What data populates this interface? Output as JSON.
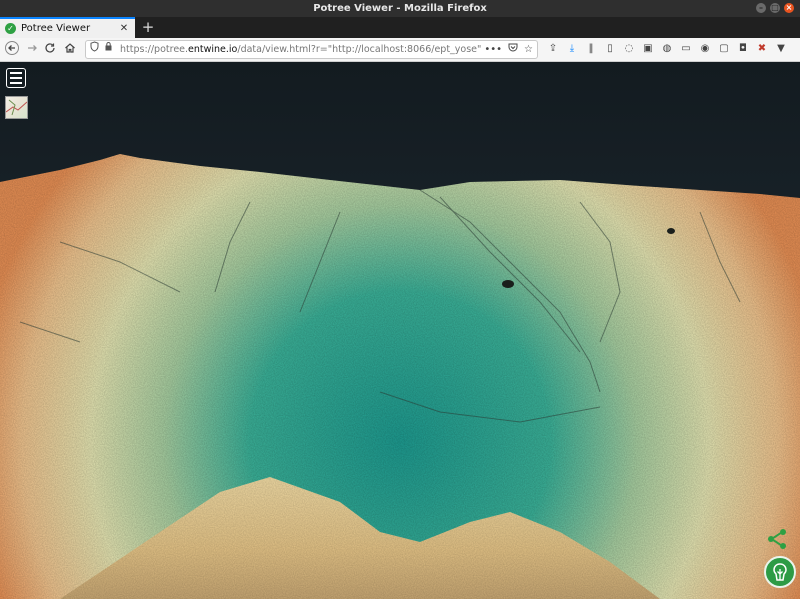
{
  "window": {
    "title": "Potree Viewer - Mozilla Firefox"
  },
  "tab": {
    "title": "Potree Viewer"
  },
  "url": {
    "prefix": "https://potree.",
    "domain": "entwine.io",
    "path": "/data/view.html?r=\"http://localhost:8066/ept_yose\""
  },
  "icons": {
    "back": "arrow-left-icon",
    "forward": "arrow-right-icon",
    "reload": "reload-icon",
    "home": "home-icon",
    "shield": "shield-icon",
    "lock": "lock-icon",
    "more": "more-icon",
    "pocket": "pocket-icon",
    "bookmark": "star-icon",
    "menu": "hamburger-menu-icon",
    "share": "share-icon",
    "logo": "potree-logo-icon"
  },
  "colors": {
    "accent": "#0a84ff",
    "viewer_bg": "#1b2429",
    "logo_green": "#2d9b45"
  }
}
